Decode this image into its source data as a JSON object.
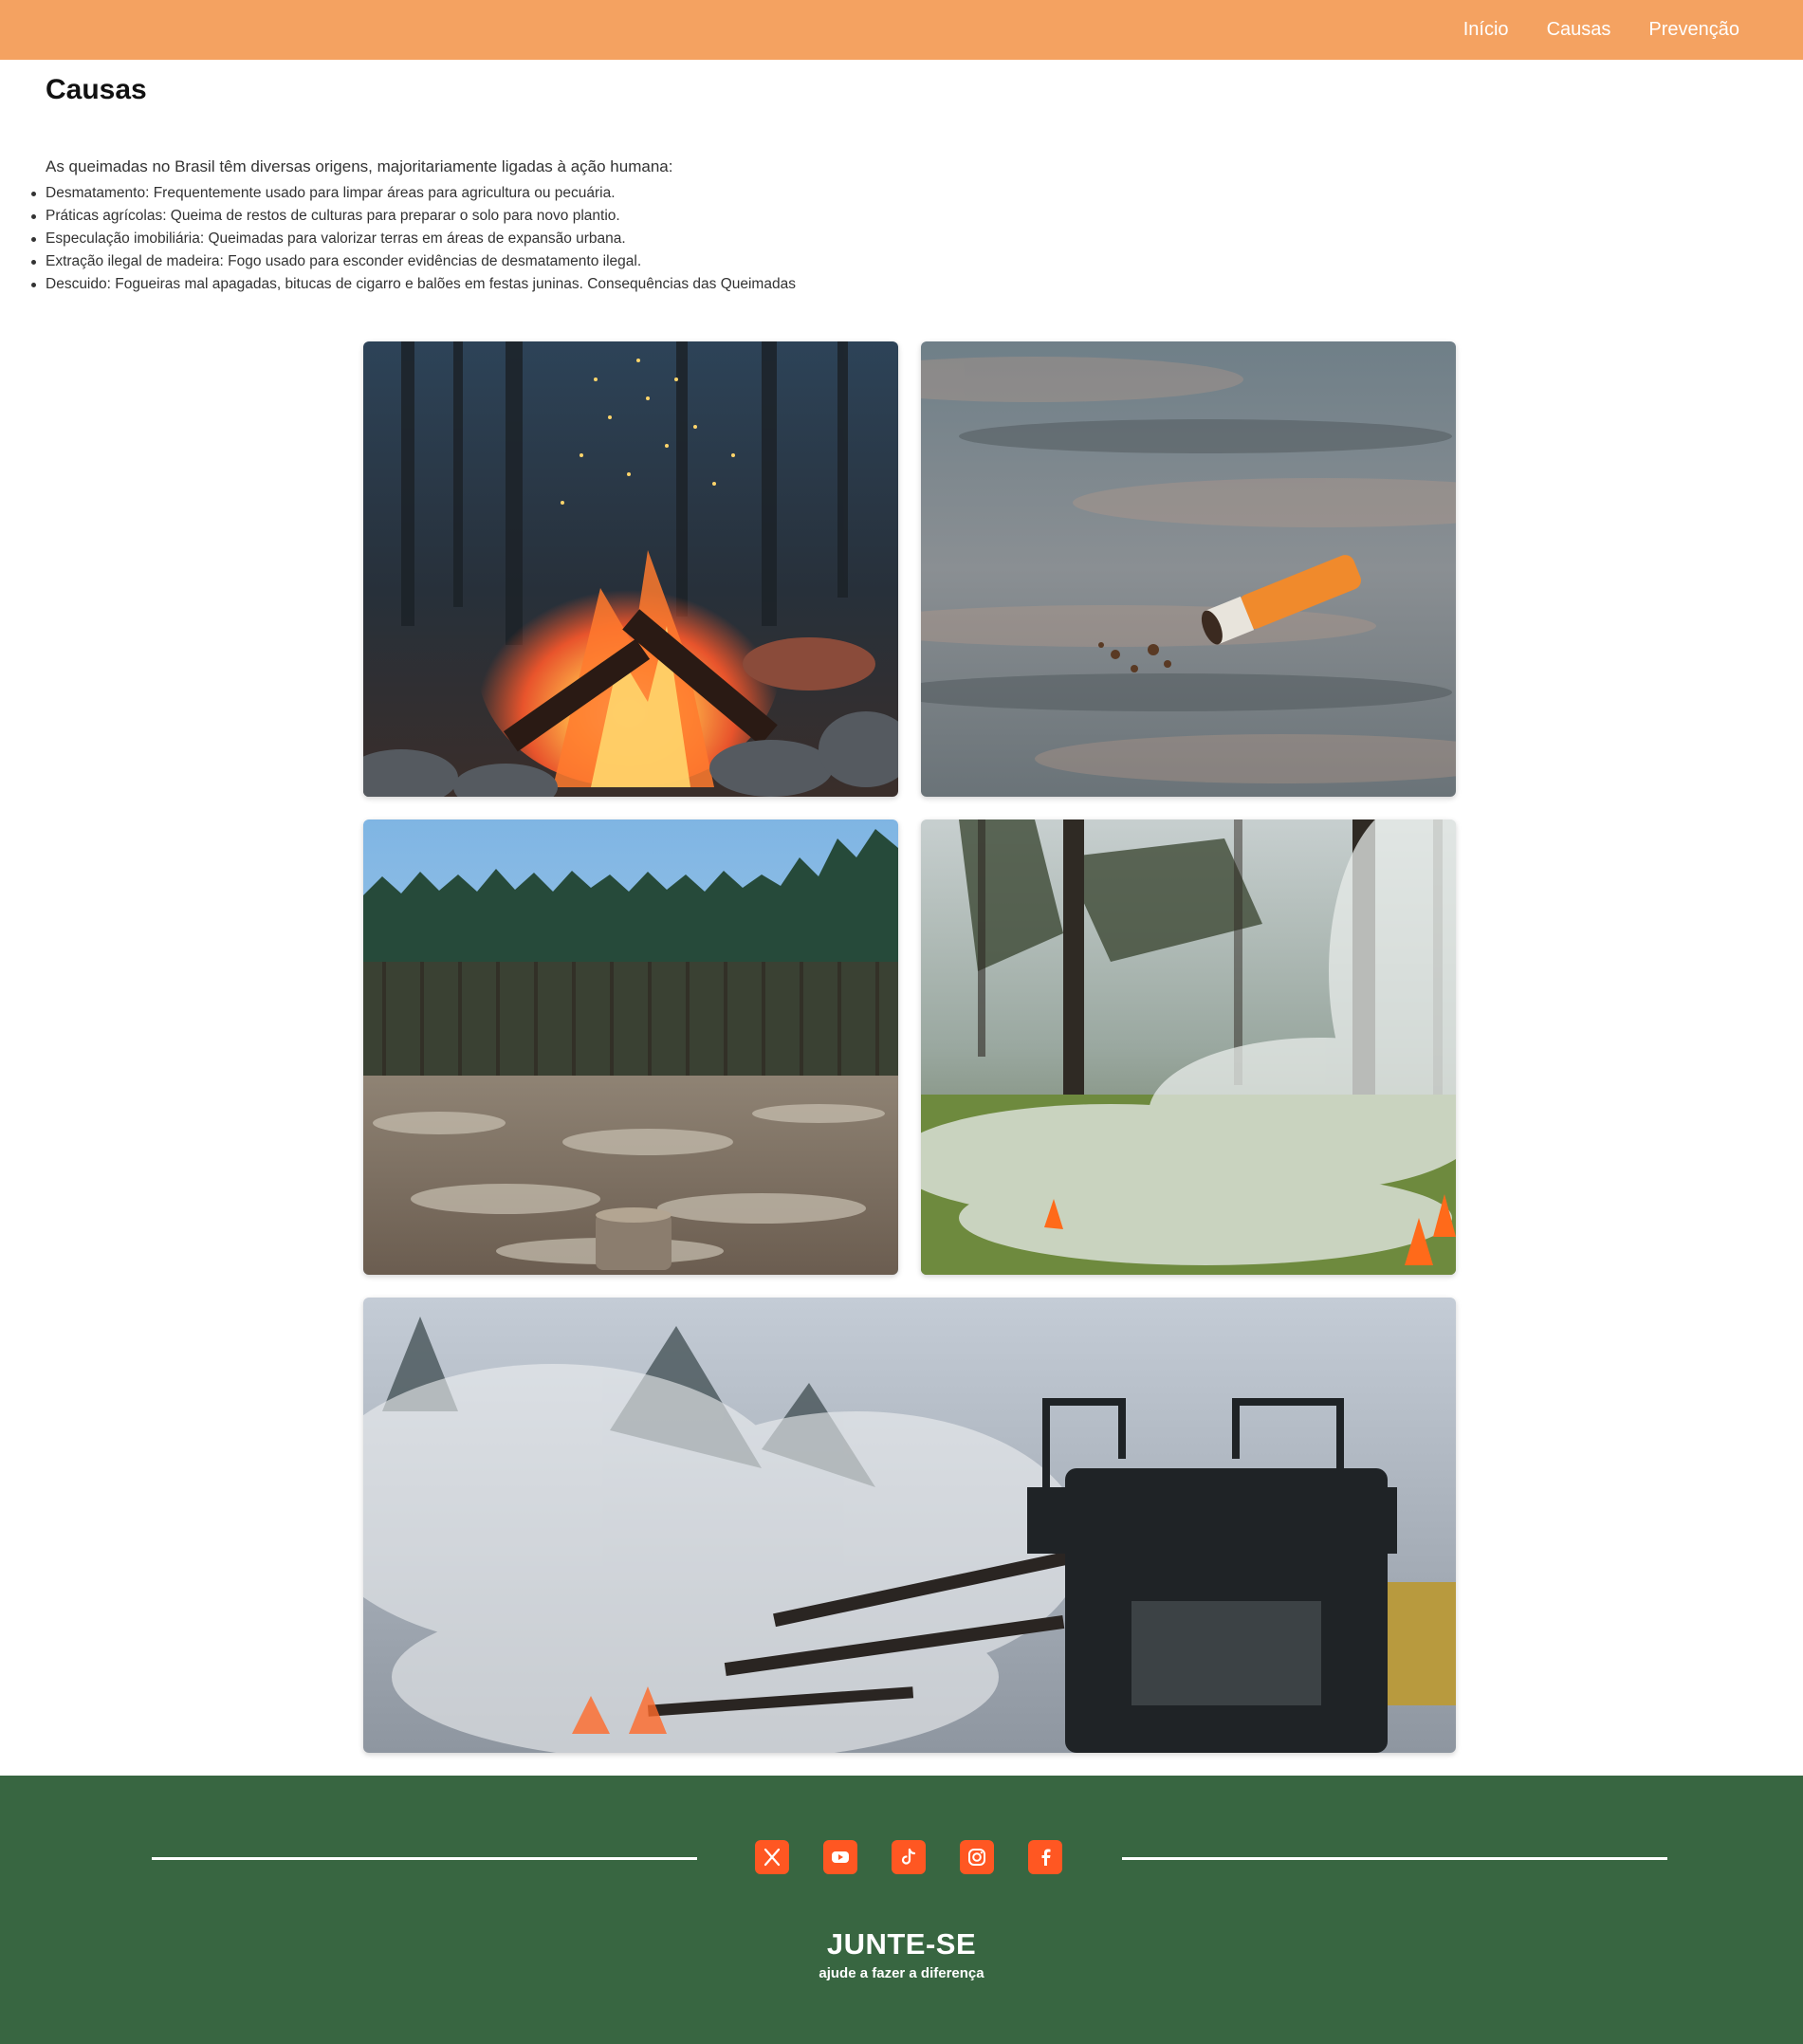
{
  "nav": {
    "items": [
      {
        "label": "Início"
      },
      {
        "label": "Causas"
      },
      {
        "label": "Prevenção"
      }
    ]
  },
  "main": {
    "title": "Causas",
    "intro": "As queimadas no Brasil têm diversas origens, majoritariamente ligadas à ação humana:",
    "causes": [
      "Desmatamento: Frequentemente usado para limpar áreas para agricultura ou pecuária.",
      "Práticas agrícolas: Queima de restos de culturas para preparar o solo para novo plantio.",
      "Especulação imobiliária: Queimadas para valorizar terras em áreas de expansão urbana.",
      "Extração ilegal de madeira: Fogo usado para esconder evidências de desmatamento ilegal.",
      "Descuido: Fogueiras mal apagadas, bitucas de cigarro e balões em festas juninas. Consequências das Queimadas"
    ]
  },
  "footer": {
    "socials": [
      {
        "icon": "x-twitter-icon"
      },
      {
        "icon": "youtube-icon"
      },
      {
        "icon": "tiktok-icon"
      },
      {
        "icon": "instagram-icon"
      },
      {
        "icon": "facebook-icon"
      }
    ],
    "title": "JUNTE-SE",
    "subtitle": "ajude a fazer a diferença"
  },
  "colors": {
    "header_bg": "#f4a261",
    "footer_bg": "#386641",
    "social_bg": "#ff5722"
  }
}
